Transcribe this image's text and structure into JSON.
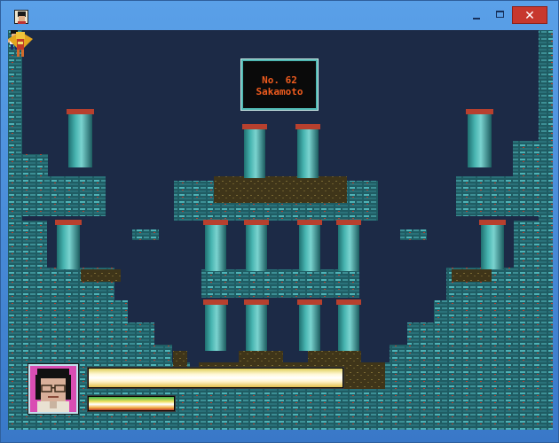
{
  "window": {
    "title": "",
    "icon": "app-portrait-icon",
    "controls": {
      "minimize_icon": "minimize-icon",
      "maximize_icon": "maximize-icon",
      "close_icon": "close-icon",
      "close_label": "✕"
    }
  },
  "game": {
    "sign": {
      "number": "No. 62",
      "name": "Sakamoto"
    },
    "hud": {
      "portrait_icon": "player-portrait",
      "hp_fraction": 1.0,
      "energy_fraction": 1.0
    },
    "sprites": {
      "player": "player-sprite",
      "boss": "winged-enemy-sprite"
    },
    "colors": {
      "background": "#1c2a46",
      "brick": "#2e7d84",
      "pillar": "#3aa6a6",
      "dirt": "#4b3f1f",
      "sign_text": "#ef5b1e",
      "portrait_bg": "#d94db3"
    }
  }
}
